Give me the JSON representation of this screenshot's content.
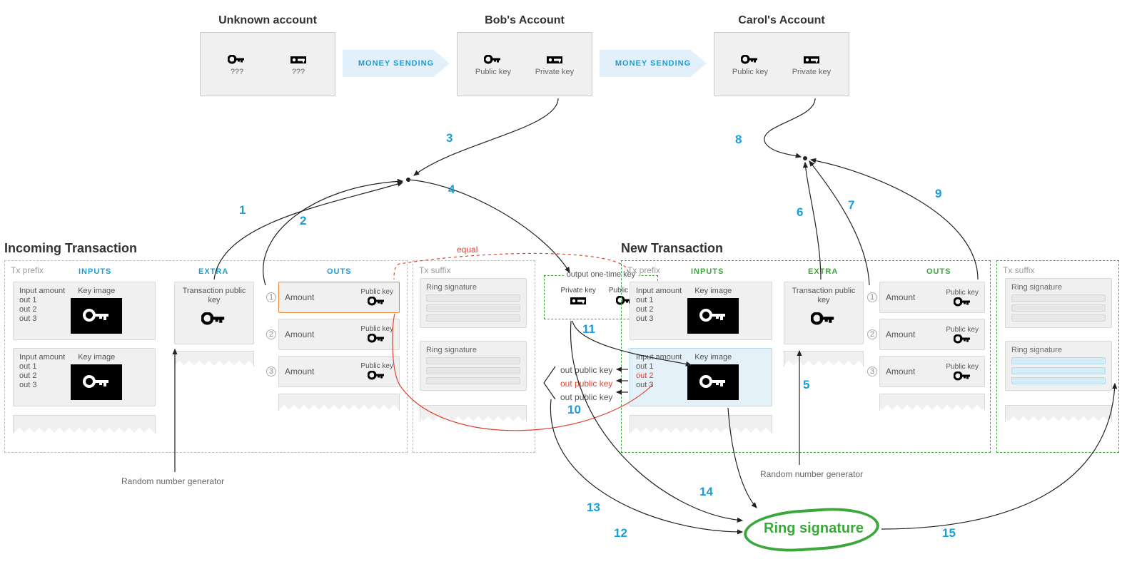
{
  "accounts": {
    "unknown": {
      "title": "Unknown account",
      "pub": "???",
      "priv": "???"
    },
    "bob": {
      "title": "Bob's Account",
      "pub": "Public key",
      "priv": "Private key"
    },
    "carol": {
      "title": "Carol's Account",
      "pub": "Public key",
      "priv": "Private key"
    }
  },
  "money_sending": "MONEY SENDING",
  "sections": {
    "incoming": "Incoming Transaction",
    "new": "New Transaction"
  },
  "tx_prefix": "Tx prefix",
  "tx_suffix": "Tx suffix",
  "headers": {
    "inputs": "INPUTS",
    "extra": "EXTRA",
    "outs": "OUTS"
  },
  "input_card": {
    "amount": "Input amount",
    "outs": [
      "out 1",
      "out 2",
      "out 3"
    ],
    "keyimage": "Key image"
  },
  "extra_card": "Transaction public key",
  "out_card": {
    "amount": "Amount",
    "pubkey": "Public key"
  },
  "ring_sig_label": "Ring signature",
  "onetime": {
    "title": "output one-time key",
    "priv": "Private key",
    "pub": "Public key"
  },
  "opk": [
    "out public key",
    "out public key",
    "out public key"
  ],
  "rng": "Random number generator",
  "equal": "equal",
  "ring_sig_final": "Ring signature",
  "nums": {
    "n1": "1",
    "n2": "2",
    "n3": "3",
    "n4": "4",
    "n5": "5",
    "n6": "6",
    "n7": "7",
    "n8": "8",
    "n9": "9",
    "n10": "10",
    "n11": "11",
    "n12": "12",
    "n13": "13",
    "n14": "14",
    "n15": "15"
  },
  "out_indices": [
    "1",
    "2",
    "3"
  ]
}
